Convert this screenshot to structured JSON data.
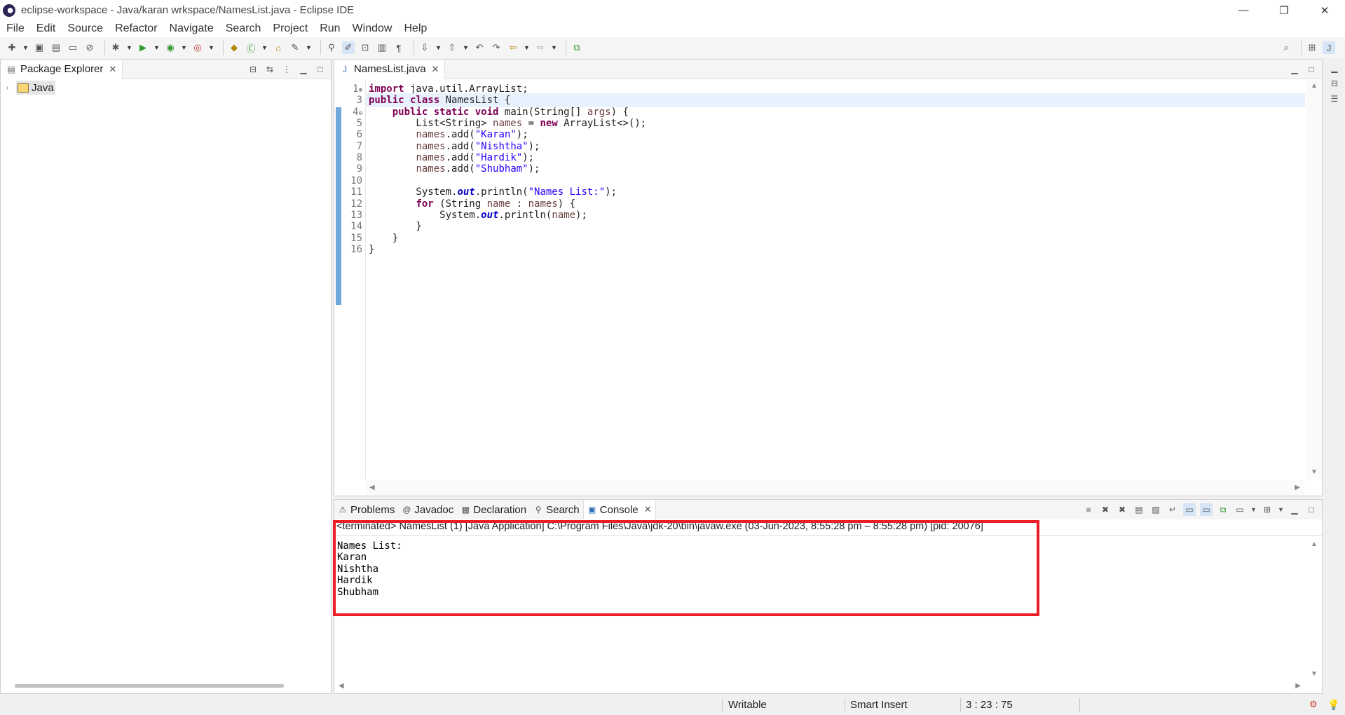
{
  "window": {
    "title": "eclipse-workspace - Java/karan wrkspace/NamesList.java - Eclipse IDE",
    "controls": [
      "—",
      "❐",
      "✕"
    ]
  },
  "menu": [
    "File",
    "Edit",
    "Source",
    "Refactor",
    "Navigate",
    "Search",
    "Project",
    "Run",
    "Window",
    "Help"
  ],
  "package_explorer": {
    "tab_label": "Package Explorer",
    "items": [
      {
        "label": "Java"
      }
    ]
  },
  "editor": {
    "tab_label": "NamesList.java",
    "lines": [
      {
        "num": "1",
        "fold": "⊕",
        "text": "import java.util.ArrayList;"
      },
      {
        "num": "3",
        "fold": "",
        "text": "public class NamesList {"
      },
      {
        "num": "4",
        "fold": "⊖",
        "text": "    public static void main(String[] args) {"
      },
      {
        "num": "5",
        "fold": "",
        "text": "        List<String> names = new ArrayList<>();"
      },
      {
        "num": "6",
        "fold": "",
        "text": "        names.add(\"Karan\");"
      },
      {
        "num": "7",
        "fold": "",
        "text": "        names.add(\"Nishtha\");"
      },
      {
        "num": "8",
        "fold": "",
        "text": "        names.add(\"Hardik\");"
      },
      {
        "num": "9",
        "fold": "",
        "text": "        names.add(\"Shubham\");"
      },
      {
        "num": "10",
        "fold": "",
        "text": ""
      },
      {
        "num": "11",
        "fold": "",
        "text": "        System.out.println(\"Names List:\");"
      },
      {
        "num": "12",
        "fold": "",
        "text": "        for (String name : names) {"
      },
      {
        "num": "13",
        "fold": "",
        "text": "            System.out.println(name);"
      },
      {
        "num": "14",
        "fold": "",
        "text": "        }"
      },
      {
        "num": "15",
        "fold": "",
        "text": "    }"
      },
      {
        "num": "16",
        "fold": "",
        "text": "}"
      }
    ]
  },
  "bottom_tabs": [
    {
      "label": "Problems",
      "icon": "problems-icon"
    },
    {
      "label": "Javadoc",
      "icon": "javadoc-icon"
    },
    {
      "label": "Declaration",
      "icon": "declaration-icon"
    },
    {
      "label": "Search",
      "icon": "search-icon"
    },
    {
      "label": "Console",
      "icon": "console-icon"
    }
  ],
  "console": {
    "header": "<terminated> NamesList (1) [Java Application] C:\\Program Files\\Java\\jdk-20\\bin\\javaw.exe  (03-Jun-2023, 8:55:28 pm – 8:55:28 pm) [pid: 20076]",
    "output": [
      "Names List:",
      "Karan",
      "Nishtha",
      "Hardik",
      "Shubham"
    ]
  },
  "status": {
    "writable": "Writable",
    "insert_mode": "Smart Insert",
    "position": "3 : 23 : 75"
  },
  "colors": {
    "highlight_box": "#ee1c25",
    "keyword": "#7f0055",
    "string": "#2a00ff",
    "field": "#0000c0",
    "local_var": "#6a3e3e",
    "change_ruler": "#6fa6dc"
  }
}
